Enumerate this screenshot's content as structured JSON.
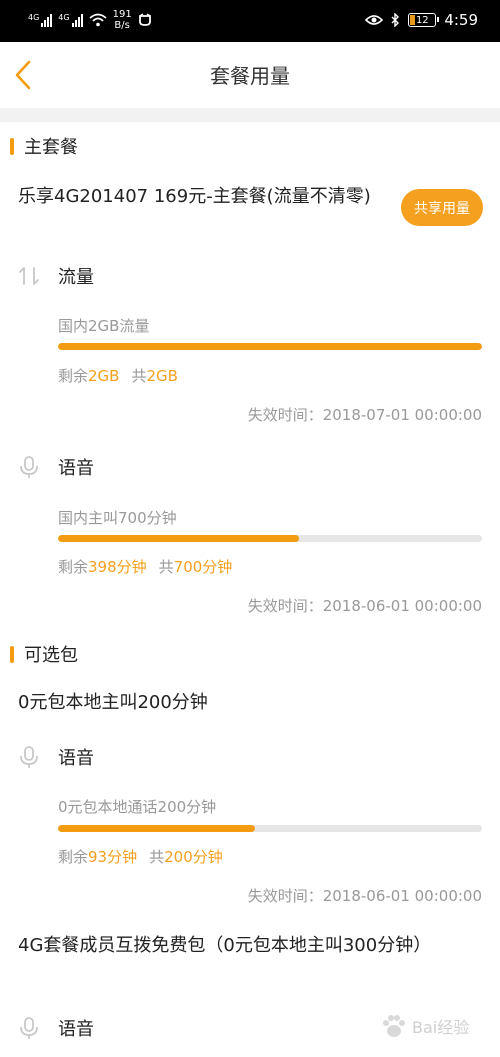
{
  "status_bar": {
    "signal1_label": "4G",
    "signal2_label": "4G",
    "speed_value": "191",
    "speed_unit": "B/s",
    "battery": "12",
    "time": "4:59"
  },
  "header": {
    "title": "套餐用量"
  },
  "main_package": {
    "section_title": "主套餐",
    "name": "乐享4G201407 169元-主套餐(流量不清零)",
    "share_button": "共享用量",
    "items": [
      {
        "type": "流量",
        "icon": "data-arrows-icon",
        "desc": "国内2GB流量",
        "remaining_label": "剩余",
        "remaining": "2GB",
        "total_label": "共",
        "total": "2GB",
        "remaining_fraction": 1.0,
        "expiry": "失效时间：2018-07-01 00:00:00"
      },
      {
        "type": "语音",
        "icon": "microphone-icon",
        "desc": "国内主叫700分钟",
        "remaining_label": "剩余",
        "remaining": "398分钟",
        "total_label": "共",
        "total": "700分钟",
        "remaining_fraction": 0.5686,
        "expiry": "失效时间：2018-06-01 00:00:00"
      }
    ]
  },
  "optional_packages": {
    "section_title": "可选包",
    "packages": [
      {
        "name": "0元包本地主叫200分钟",
        "item": {
          "type": "语音",
          "icon": "microphone-icon",
          "desc": "0元包本地通话200分钟",
          "remaining_label": "剩余",
          "remaining": "93分钟",
          "total_label": "共",
          "total": "200分钟",
          "remaining_fraction": 0.465,
          "expiry": "失效时间：2018-06-01 00:00:00"
        }
      },
      {
        "name": "4G套餐成员互拨免费包（0元包本地主叫300分钟）",
        "item": {
          "type": "语音",
          "icon": "microphone-icon"
        }
      }
    ]
  },
  "watermark": {
    "text": "Bai经验"
  },
  "colors": {
    "accent": "#f39c12",
    "button": "#f5a01f",
    "muted": "#999999"
  }
}
